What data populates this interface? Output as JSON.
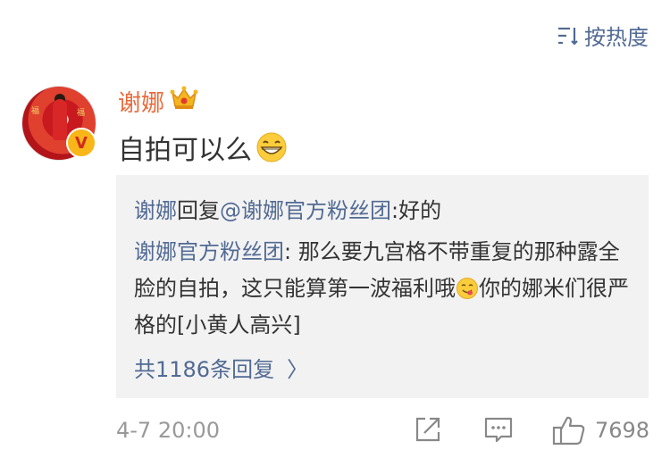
{
  "sort": {
    "label": "按热度",
    "icon": "sort-lines-icon"
  },
  "comment": {
    "username": "谢娜",
    "text": "自拍可以么",
    "emoji": "grinning-face",
    "timestamp": "4-7 20:00",
    "like_count": "7698"
  },
  "reply_box": {
    "first_reply": {
      "author": "谢娜",
      "action": "回复",
      "mention": "@谢娜官方粉丝团",
      "text": ":好的"
    },
    "second_reply": {
      "author": "谢娜官方粉丝团",
      "text_part1": ": 那么要九宫格不带重复的那种露全脸的自拍，这只能算第一波福利哦",
      "text_part2": "你的娜米们很严格的[小黄人高兴]"
    },
    "more_replies": "共1186条回复"
  },
  "colors": {
    "link": "#526a94",
    "username": "#ea6a3a",
    "reply_bg": "#f2f2f2"
  }
}
